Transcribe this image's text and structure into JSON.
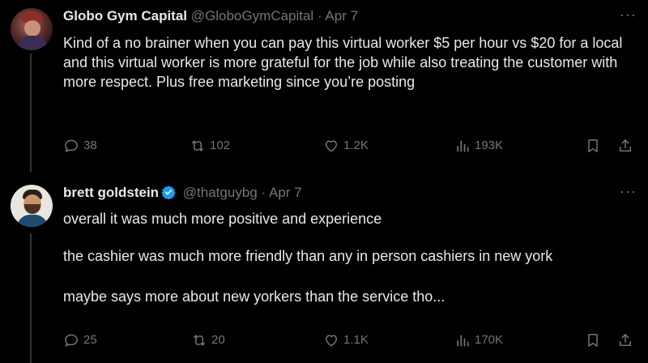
{
  "tweets": [
    {
      "name": "Globo Gym Capital",
      "handle": "@GloboGymCapital",
      "separator": "·",
      "date": "Apr 7",
      "more": "···",
      "paragraphs": [
        "Kind of a no brainer when you can pay this virtual worker $5 per hour vs $20 for a local and this virtual worker is more grateful for the job while also treating the customer with more respect. Plus free marketing since you’re posting"
      ],
      "replies": "38",
      "retweets": "102",
      "likes": "1.2K",
      "views": "193K",
      "verified": false
    },
    {
      "name": "brett goldstein",
      "handle": "@thatguybg",
      "separator": "·",
      "date": "Apr 7",
      "more": "···",
      "paragraphs": [
        "overall it was much more positive and experience",
        "the cashier was much more friendly than any in person cashiers in new york",
        "maybe says more about new yorkers than the service tho..."
      ],
      "replies": "25",
      "retweets": "20",
      "likes": "1.1K",
      "views": "170K",
      "verified": true,
      "verified_color": "#1d9bf0"
    }
  ],
  "colors": {
    "background": "#000000",
    "text": "#e7e9ea",
    "muted": "#71767b",
    "thread_line": "#333639"
  }
}
